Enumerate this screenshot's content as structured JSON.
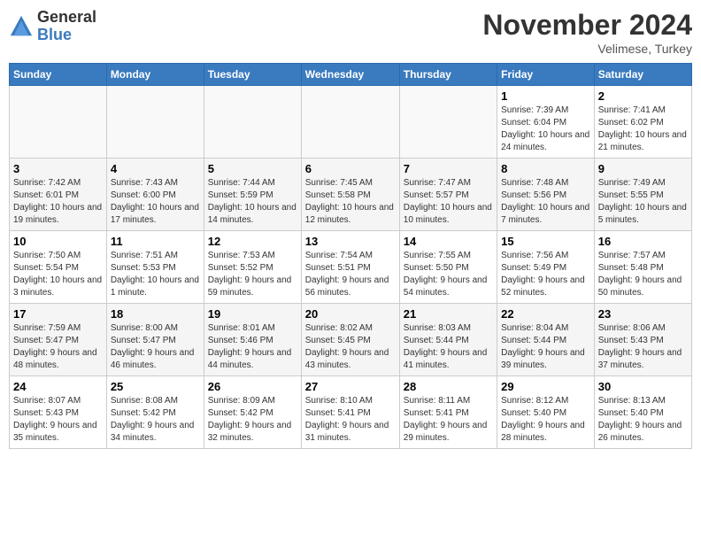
{
  "logo": {
    "general": "General",
    "blue": "Blue"
  },
  "header": {
    "month": "November 2024",
    "location": "Velimese, Turkey"
  },
  "days_of_week": [
    "Sunday",
    "Monday",
    "Tuesday",
    "Wednesday",
    "Thursday",
    "Friday",
    "Saturday"
  ],
  "weeks": [
    [
      {
        "day": "",
        "info": ""
      },
      {
        "day": "",
        "info": ""
      },
      {
        "day": "",
        "info": ""
      },
      {
        "day": "",
        "info": ""
      },
      {
        "day": "",
        "info": ""
      },
      {
        "day": "1",
        "info": "Sunrise: 7:39 AM\nSunset: 6:04 PM\nDaylight: 10 hours and 24 minutes."
      },
      {
        "day": "2",
        "info": "Sunrise: 7:41 AM\nSunset: 6:02 PM\nDaylight: 10 hours and 21 minutes."
      }
    ],
    [
      {
        "day": "3",
        "info": "Sunrise: 7:42 AM\nSunset: 6:01 PM\nDaylight: 10 hours and 19 minutes."
      },
      {
        "day": "4",
        "info": "Sunrise: 7:43 AM\nSunset: 6:00 PM\nDaylight: 10 hours and 17 minutes."
      },
      {
        "day": "5",
        "info": "Sunrise: 7:44 AM\nSunset: 5:59 PM\nDaylight: 10 hours and 14 minutes."
      },
      {
        "day": "6",
        "info": "Sunrise: 7:45 AM\nSunset: 5:58 PM\nDaylight: 10 hours and 12 minutes."
      },
      {
        "day": "7",
        "info": "Sunrise: 7:47 AM\nSunset: 5:57 PM\nDaylight: 10 hours and 10 minutes."
      },
      {
        "day": "8",
        "info": "Sunrise: 7:48 AM\nSunset: 5:56 PM\nDaylight: 10 hours and 7 minutes."
      },
      {
        "day": "9",
        "info": "Sunrise: 7:49 AM\nSunset: 5:55 PM\nDaylight: 10 hours and 5 minutes."
      }
    ],
    [
      {
        "day": "10",
        "info": "Sunrise: 7:50 AM\nSunset: 5:54 PM\nDaylight: 10 hours and 3 minutes."
      },
      {
        "day": "11",
        "info": "Sunrise: 7:51 AM\nSunset: 5:53 PM\nDaylight: 10 hours and 1 minute."
      },
      {
        "day": "12",
        "info": "Sunrise: 7:53 AM\nSunset: 5:52 PM\nDaylight: 9 hours and 59 minutes."
      },
      {
        "day": "13",
        "info": "Sunrise: 7:54 AM\nSunset: 5:51 PM\nDaylight: 9 hours and 56 minutes."
      },
      {
        "day": "14",
        "info": "Sunrise: 7:55 AM\nSunset: 5:50 PM\nDaylight: 9 hours and 54 minutes."
      },
      {
        "day": "15",
        "info": "Sunrise: 7:56 AM\nSunset: 5:49 PM\nDaylight: 9 hours and 52 minutes."
      },
      {
        "day": "16",
        "info": "Sunrise: 7:57 AM\nSunset: 5:48 PM\nDaylight: 9 hours and 50 minutes."
      }
    ],
    [
      {
        "day": "17",
        "info": "Sunrise: 7:59 AM\nSunset: 5:47 PM\nDaylight: 9 hours and 48 minutes."
      },
      {
        "day": "18",
        "info": "Sunrise: 8:00 AM\nSunset: 5:47 PM\nDaylight: 9 hours and 46 minutes."
      },
      {
        "day": "19",
        "info": "Sunrise: 8:01 AM\nSunset: 5:46 PM\nDaylight: 9 hours and 44 minutes."
      },
      {
        "day": "20",
        "info": "Sunrise: 8:02 AM\nSunset: 5:45 PM\nDaylight: 9 hours and 43 minutes."
      },
      {
        "day": "21",
        "info": "Sunrise: 8:03 AM\nSunset: 5:44 PM\nDaylight: 9 hours and 41 minutes."
      },
      {
        "day": "22",
        "info": "Sunrise: 8:04 AM\nSunset: 5:44 PM\nDaylight: 9 hours and 39 minutes."
      },
      {
        "day": "23",
        "info": "Sunrise: 8:06 AM\nSunset: 5:43 PM\nDaylight: 9 hours and 37 minutes."
      }
    ],
    [
      {
        "day": "24",
        "info": "Sunrise: 8:07 AM\nSunset: 5:43 PM\nDaylight: 9 hours and 35 minutes."
      },
      {
        "day": "25",
        "info": "Sunrise: 8:08 AM\nSunset: 5:42 PM\nDaylight: 9 hours and 34 minutes."
      },
      {
        "day": "26",
        "info": "Sunrise: 8:09 AM\nSunset: 5:42 PM\nDaylight: 9 hours and 32 minutes."
      },
      {
        "day": "27",
        "info": "Sunrise: 8:10 AM\nSunset: 5:41 PM\nDaylight: 9 hours and 31 minutes."
      },
      {
        "day": "28",
        "info": "Sunrise: 8:11 AM\nSunset: 5:41 PM\nDaylight: 9 hours and 29 minutes."
      },
      {
        "day": "29",
        "info": "Sunrise: 8:12 AM\nSunset: 5:40 PM\nDaylight: 9 hours and 28 minutes."
      },
      {
        "day": "30",
        "info": "Sunrise: 8:13 AM\nSunset: 5:40 PM\nDaylight: 9 hours and 26 minutes."
      }
    ]
  ]
}
